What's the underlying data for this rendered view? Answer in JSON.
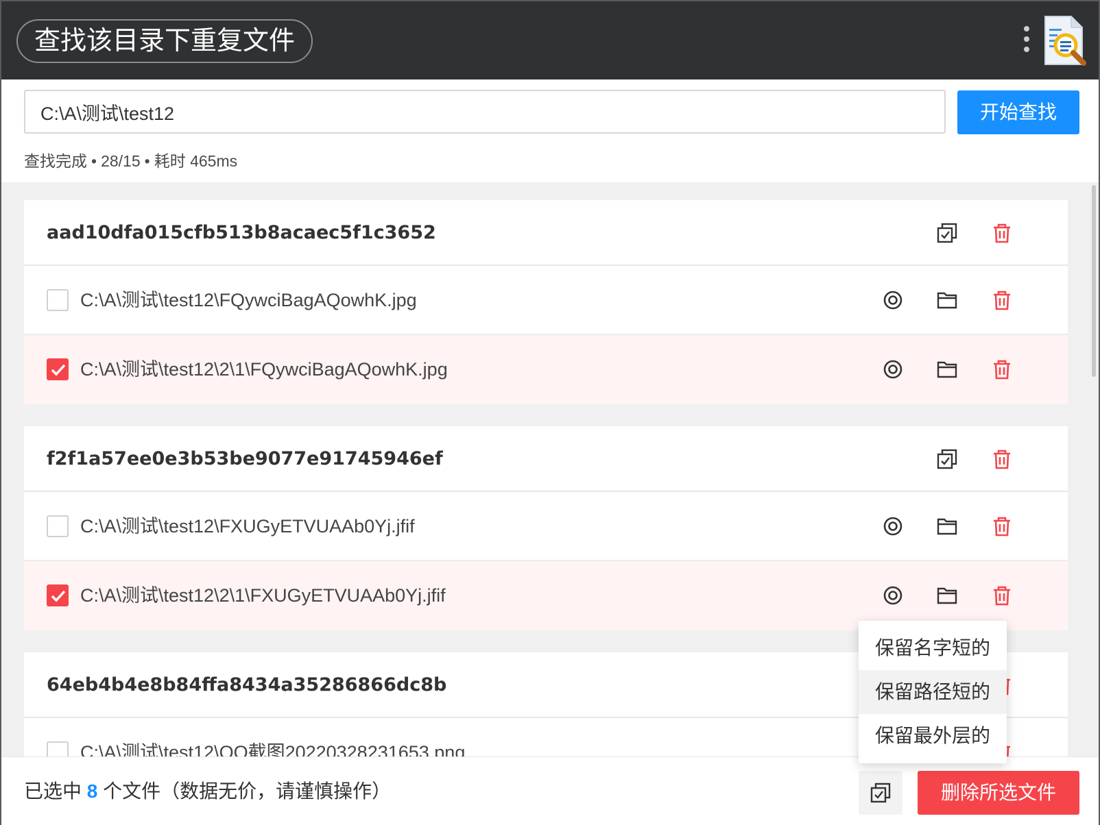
{
  "title": "查找该目录下重复文件",
  "search": {
    "path_value": "C:\\A\\测试\\test12",
    "start_label": "开始查找"
  },
  "status": {
    "state": "查找完成",
    "ratio": "28/15",
    "elapsed": "耗时 465ms"
  },
  "groups": [
    {
      "hash": "aad10dfa015cfb513b8acaec5f1c3652",
      "files": [
        {
          "path": "C:\\A\\测试\\test12\\FQywciBagAQowhK.jpg",
          "checked": false
        },
        {
          "path": "C:\\A\\测试\\test12\\2\\1\\FQywciBagAQowhK.jpg",
          "checked": true
        }
      ]
    },
    {
      "hash": "f2f1a57ee0e3b53be9077e91745946ef",
      "files": [
        {
          "path": "C:\\A\\测试\\test12\\FXUGyETVUAAb0Yj.jfif",
          "checked": false
        },
        {
          "path": "C:\\A\\测试\\test12\\2\\1\\FXUGyETVUAAb0Yj.jfif",
          "checked": true
        }
      ]
    },
    {
      "hash": "64eb4b4e8b84ffa8434a35286866dc8b",
      "files": [
        {
          "path": "C:\\A\\测试\\test12\\QQ截图20220328231653.png",
          "checked": false
        }
      ]
    }
  ],
  "dropdown": {
    "items": [
      "保留名字短的",
      "保留路径短的",
      "保留最外层的"
    ]
  },
  "footer": {
    "prefix": "已选中",
    "count": "8",
    "suffix": "个文件（数据无价，请谨慎操作）",
    "delete_label": "删除所选文件"
  },
  "colors": {
    "accent": "#1890ff",
    "danger": "#f5454a",
    "titlebar": "#2f3133",
    "selected_row": "#fff3f3"
  },
  "icons": {
    "group_select": "multi-select-icon",
    "delete": "trash-icon",
    "preview": "eye-icon",
    "open_folder": "folder-icon",
    "menu": "more-vertical-icon",
    "logo": "file-search-icon"
  }
}
